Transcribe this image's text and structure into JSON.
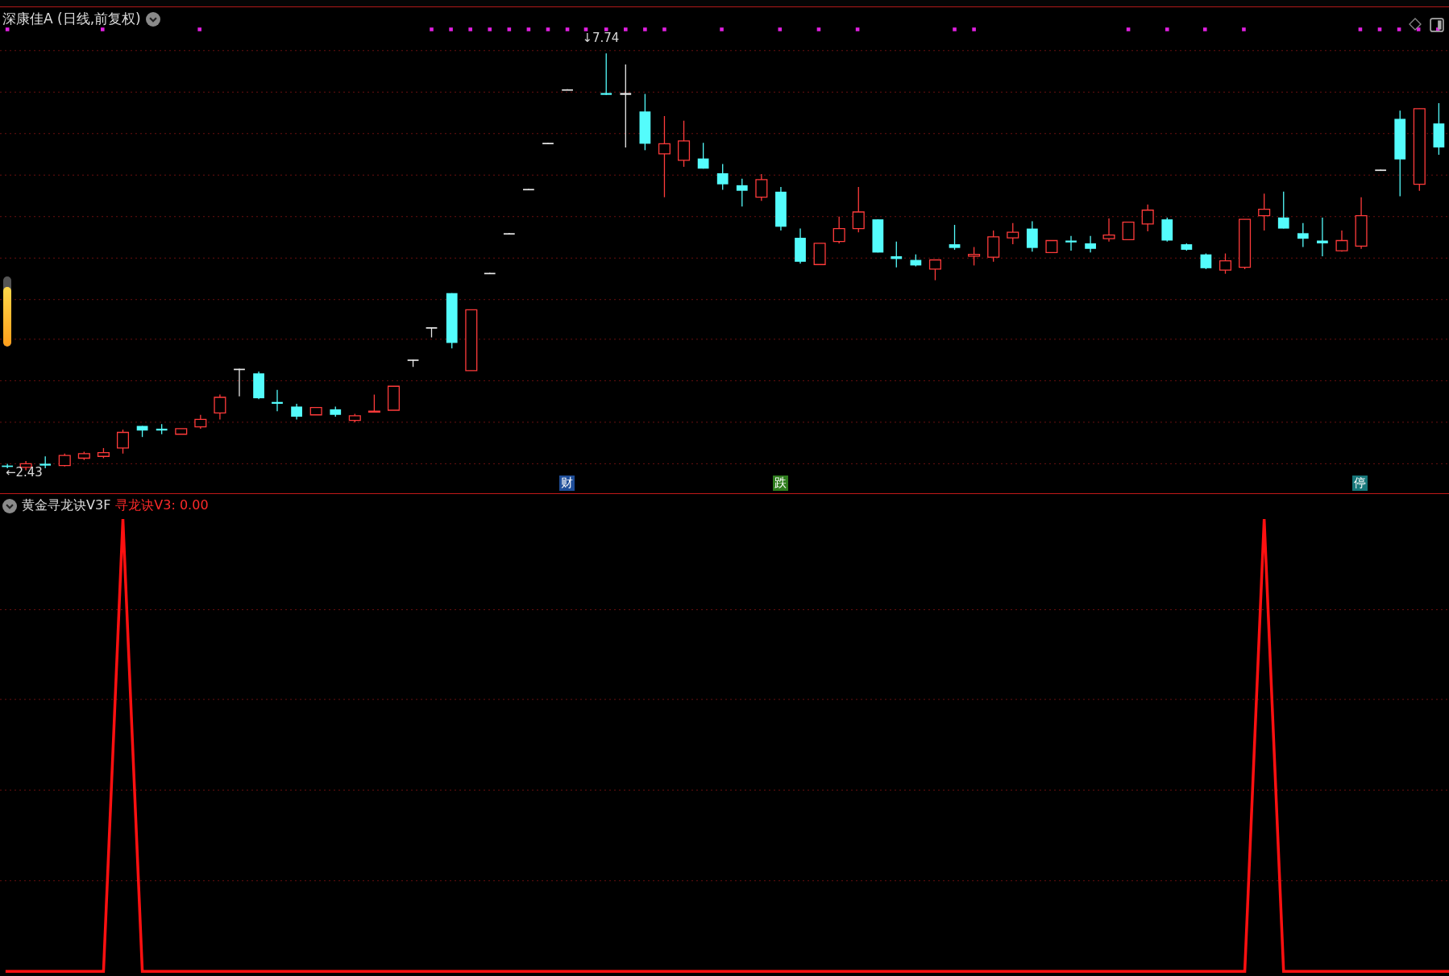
{
  "header": {
    "title": "深康佳A (日线,前复权)"
  },
  "price_chart": {
    "high_label": "↓7.74",
    "low_label": "←2.43",
    "events": [
      {
        "label": "财",
        "color": "#1f4e99"
      },
      {
        "label": "跌",
        "color": "#2f7d1e"
      },
      {
        "label": "停",
        "color": "#17777a"
      }
    ]
  },
  "gauge": {
    "level": 0.85
  },
  "indicator": {
    "name": "黄金寻龙诀V3F",
    "reading": "寻龙诀V3: 0.00"
  }
}
